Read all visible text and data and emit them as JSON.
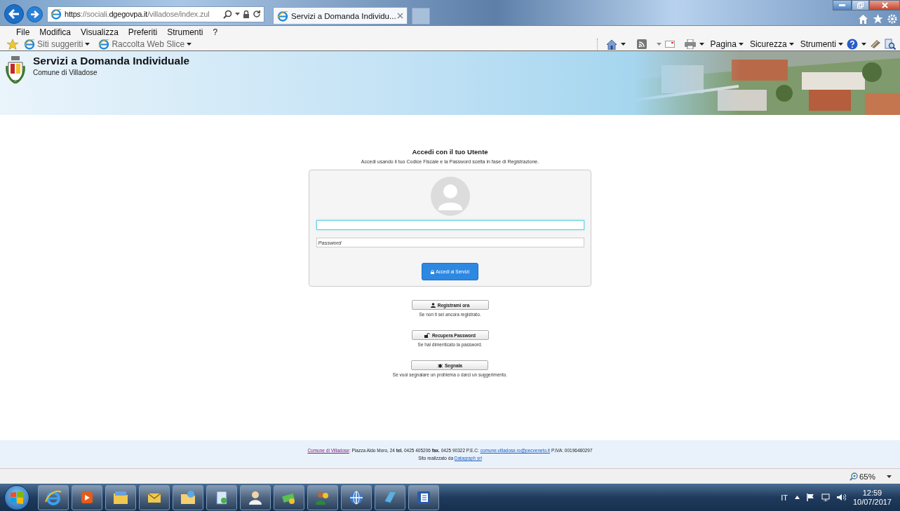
{
  "browser": {
    "address": [
      {
        "text": "https",
        "strong": true
      },
      {
        "text": "://sociali.",
        "strong": false
      },
      {
        "text": "dgegovpa.it",
        "strong": true
      },
      {
        "text": "/villadose/index.zul",
        "strong": false
      }
    ],
    "tab": {
      "title": "Servizi a Domanda Individu...",
      "selected": true
    },
    "menu": [
      "File",
      "Modifica",
      "Visualizza",
      "Preferiti",
      "Strumenti",
      "?"
    ],
    "favorites": [
      "Siti suggeriti",
      "Raccolta Web Slice"
    ],
    "command_bar": [
      "Pagina",
      "Sicurezza",
      "Strumenti"
    ]
  },
  "banner": {
    "title": "Servizi a Domanda Individuale",
    "subtitle": "Comune di Villadose"
  },
  "login": {
    "title": "Accedi con il tuo Utente",
    "hint": "Accedi usando il tuo Codice Fiscale e la Password scelta in fase di Registrazione.",
    "username": {
      "focused": true
    },
    "password": {
      "placeholder": "Password",
      "focused": false
    },
    "submit": "Accedi ai Servizi"
  },
  "actions": [
    {
      "kind": "user",
      "label": "Registrami ora",
      "caption": "Se non ti sei ancora registrato."
    },
    {
      "kind": "unlock",
      "label": "Recupera Password",
      "caption": "Se hai dimenticato la password."
    },
    {
      "kind": "bug",
      "label": "Segnala",
      "caption": "Se vuoi segnalare un problema o darci un suggerimento."
    }
  ],
  "footer": {
    "contact": [
      {
        "kind": "link",
        "text": "Comune di Villadose",
        "visited": true
      },
      {
        "kind": "text",
        "text": ": Piazza Aldo Moro, 24 **tel.** 0425 405206 **fax.** 0425 90322 P.E.C: "
      },
      {
        "kind": "link",
        "text": "comune.villadose.ro@pecveneto.it",
        "visited": false
      },
      {
        "kind": "text",
        "text": " P.IVA: 00196480297"
      }
    ],
    "credit": [
      {
        "kind": "text",
        "text": "Sito realizzato da "
      },
      {
        "kind": "link",
        "text": "Datagraph srl",
        "visited": false
      }
    ]
  },
  "status_bar": {
    "zoom": "65%"
  },
  "taskbar": {
    "language": "IT",
    "time": "12:59",
    "date": "10/07/2017"
  }
}
